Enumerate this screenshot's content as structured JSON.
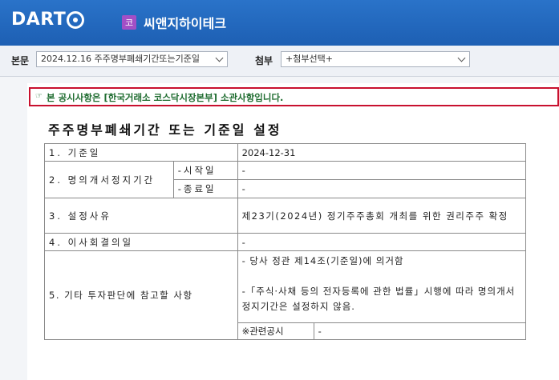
{
  "header": {
    "logo_text": "DART",
    "company_badge": "코",
    "company_name": "씨앤지하이테크"
  },
  "filters": {
    "main_label": "본문",
    "main_value": "2024.12.16  주주명부폐쇄기간또는기준일",
    "attach_label": "첨부",
    "attach_value": "+첨부선택+"
  },
  "notice": {
    "icon": "☞",
    "text": "본 공시사항은 [한국거래소 코스닥시장본부] 소관사항입니다."
  },
  "document": {
    "title": "주주명부폐쇄기간 또는 기준일 설정",
    "rows": {
      "record_date": {
        "label": "1. 기준일",
        "value": "2024-12-31"
      },
      "closure_period": {
        "label": "2. 명의개서정지기간",
        "start_label": "-시작일",
        "start_value": "-",
        "end_label": "-종료일",
        "end_value": "-"
      },
      "reason": {
        "label": "3. 설정사유",
        "value": "제23기(2024년) 정기주주총회 개최를 위한 권리주주 확정"
      },
      "board_date": {
        "label": "4. 이사회결의일",
        "value": "-"
      },
      "other": {
        "label": "5. 기타 투자판단에 참고할 사항",
        "line1": "- 당사 정관 제14조(기준일)에 의거함",
        "line2": "-「주식·사채 등의 전자등록에 관한 법률」시행에 따라 명의개서정지기간은 설정하지 않음.",
        "related_label": "※관련공시",
        "related_value": "-"
      }
    }
  }
}
